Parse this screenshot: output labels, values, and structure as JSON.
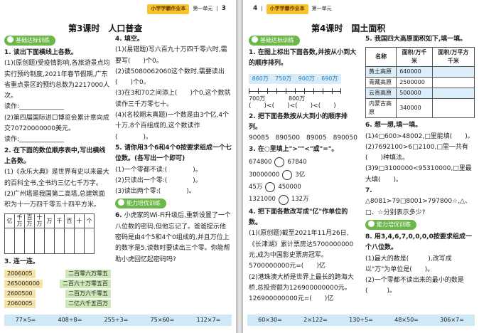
{
  "left_page": {
    "header": {
      "series": "小学学霸作业本",
      "unit": "第一单元",
      "page_number": "3"
    },
    "lesson_title": "第3课时　人口普查",
    "tag_basic": "基础达标训练",
    "tag_ability": "能力培优训练",
    "q1": {
      "title": "1. 读出下面横线上各数。",
      "p1": "(1)(原创题)受疫情影响,各旅游景点均实行预约制度,2021年春节假期,广东省重点景区的预约总数为2217000人次。",
      "p1_read": "读作:______________",
      "p2": "(2)第四届国际进口博览会累计意向成交70720000000美元。",
      "p2_read": "读作:______________"
    },
    "q2": {
      "title": "2. 在下面的数位顺序表中,写出横线上各数。",
      "p1": "(1)《永乐大典》是世界有史以来最大的百科全书,全书约三亿七千万字。",
      "p2": "(2)广州塔是我国第二高塔,总建筑面积为十一万四千零五十四平方米。",
      "table_header": [
        "亿",
        "千万",
        "百万",
        "十万",
        "万",
        "千",
        "百",
        "十",
        "个"
      ]
    },
    "q3": {
      "title": "3. 连一连。",
      "left": [
        "2006005",
        "265000000",
        "2600500",
        "2060005"
      ],
      "right": [
        "二百零六万零五",
        "二百六十万零五百",
        "二百万六千零五",
        "二亿六千五百万"
      ]
    },
    "q4": {
      "title": "4. 填空。",
      "items": [
        "(1)(易错题)写六百九十万四千零六时,需要写(　　)个0。",
        "(2)读5080062060这个数时,需要读出(　　)个0。",
        "(3)在3和70之间添上(　　)个0,这个数就读作三千万零七十。",
        "(4)(名校期末真题)一个数是由3个亿,4个十万,8个百组成的,这个数读作(　　　　)。"
      ]
    },
    "q5": {
      "title": "5. 请你用3个6和4个0按要求组成一个七位数。(各写出一个即可)",
      "items": [
        "(1)一个零都不读:(　　　　)。",
        "(2)只读出一个零:(　　　　)。",
        "(3)读出两个零:(　　　　)。"
      ]
    },
    "q6": {
      "title": "6.",
      "text": "小虎家的Wi-Fi升级后,重新设置了一个八位数的密码,但他忘记了。爸爸提示他密码是由4个5和4个0组成的,并且万位上的数字是5,读数时要读出三个零。你能帮助小虎回忆起密码吗?"
    },
    "footer": [
      "77×5=",
      "408÷8=",
      "255÷3=",
      "75×60=",
      "112×7="
    ]
  },
  "right_page": {
    "header": {
      "series": "小学学霸作业本",
      "unit": "第一单元",
      "page_number": "4"
    },
    "lesson_title": "第4课时　国土面积",
    "tag_basic": "基础达标训练",
    "tag_ability": "能力培优训练",
    "q1": {
      "title": "1. 在图上标出下面各数,并按从小到大的顺序排列。",
      "values": [
        "860万",
        "750万",
        "900万",
        "690万"
      ],
      "axis_labels": [
        "700万",
        "800万"
      ],
      "order": "(　　)<(　　)<(　　)<(　　)"
    },
    "q2": {
      "title": "2. 把下面各数按从大到小的顺序排列。",
      "numbers": "90085　890500　89005　890050"
    },
    "q3": {
      "title": "3. 在○里填上\">\"\"<\"或\"=\"。",
      "rows": [
        {
          "a": "674800",
          "b": "67840"
        },
        {
          "a": "30000000",
          "b": "3亿"
        },
        {
          "a": "45万",
          "b": "450000"
        },
        {
          "a": "1321000",
          "b": "132万"
        }
      ]
    },
    "q4": {
      "title": "4. 把下面各数改写成\"亿\"作单位的数。",
      "p1": "(1)(原创题)截至2021年11月26日,《长津湖》累计票房达5700000000元,成为中国影史票房冠军。",
      "p1_eq": "5700000000元=(　　)亿",
      "p2": "(2)港珠澳大桥是世界上最长的跨海大桥,总投资额为126900000000元。",
      "p2_eq": "126900000000元=(　　)亿"
    },
    "q5": {
      "title": "5. 我国四大高原面积如下,填一填。",
      "headers": [
        "名称",
        "面积/万千米",
        "面积/万平方千米"
      ],
      "rows": [
        [
          "黄土高原",
          "640000",
          ""
        ],
        [
          "青藏高原",
          "2500000",
          ""
        ],
        [
          "云贵高原",
          "500000",
          ""
        ],
        [
          "内蒙古高原",
          "340000",
          ""
        ]
      ]
    },
    "q6": {
      "title": "6. 想一想,填一填。",
      "items": [
        "(1)4□600>48002,□里能填(　　)。",
        "(2)7692100>6□2100,□里一共有(　　)种填法。",
        "(3)9□3100000<95310000,□里最大填(　　)。"
      ]
    },
    "q7": {
      "title": "7.",
      "text": "△8081>79□8001>797800☆,△、□、☆分别表示多少?"
    },
    "q8": {
      "title": "8. 用3,4,6,7,0,0,0,0按要求组成一个八位数。",
      "items": [
        "(1)最大的数是(　　　),改写成以\"万\"为单位是(　　)。",
        "(2)一个零都不读出来的最小的数是(　　　)。"
      ]
    },
    "footer": [
      "60×30=",
      "2×122=",
      "130÷5=",
      "48×50=",
      "306×7="
    ]
  },
  "colors": {
    "accent_green": "#6bb74a",
    "accent_blue": "#1e7fc2",
    "accent_red": "#d43a2f",
    "header_yellow": "#f7c52b",
    "footer_blue": "#cfe9f7"
  }
}
